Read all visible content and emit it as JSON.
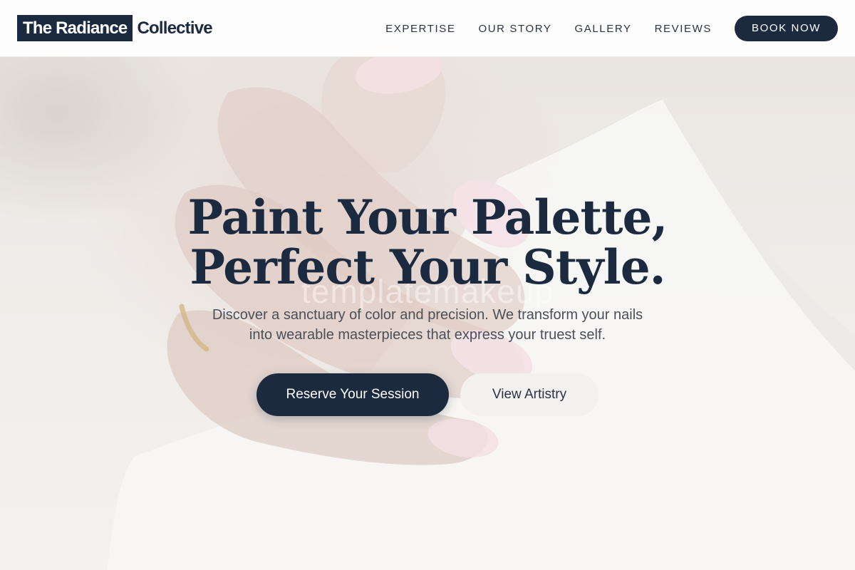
{
  "brand": {
    "logo_primary": "The Radiance",
    "logo_secondary": "Collective",
    "colors": {
      "navy": "#1c2a40",
      "header_bg": "#ffffff",
      "secondary_button_bg": "#f3f1ef",
      "text_muted": "#4b4f58"
    }
  },
  "nav": {
    "links": [
      {
        "label": "EXPERTISE"
      },
      {
        "label": "OUR STORY"
      },
      {
        "label": "GALLERY"
      },
      {
        "label": "REVIEWS"
      }
    ],
    "cta_label": "BOOK NOW"
  },
  "hero": {
    "title_line1": "Paint Your Palette,",
    "title_line2": "Perfect Your Style.",
    "watermark": "templatemakeup",
    "subtitle_line1": "Discover a sanctuary of color and precision. We transform your nails",
    "subtitle_line2": "into wearable masterpieces that express your truest self.",
    "primary_cta": "Reserve Your Session",
    "secondary_cta": "View Artistry",
    "background_image": "hand-with-pink-nails-photo"
  }
}
